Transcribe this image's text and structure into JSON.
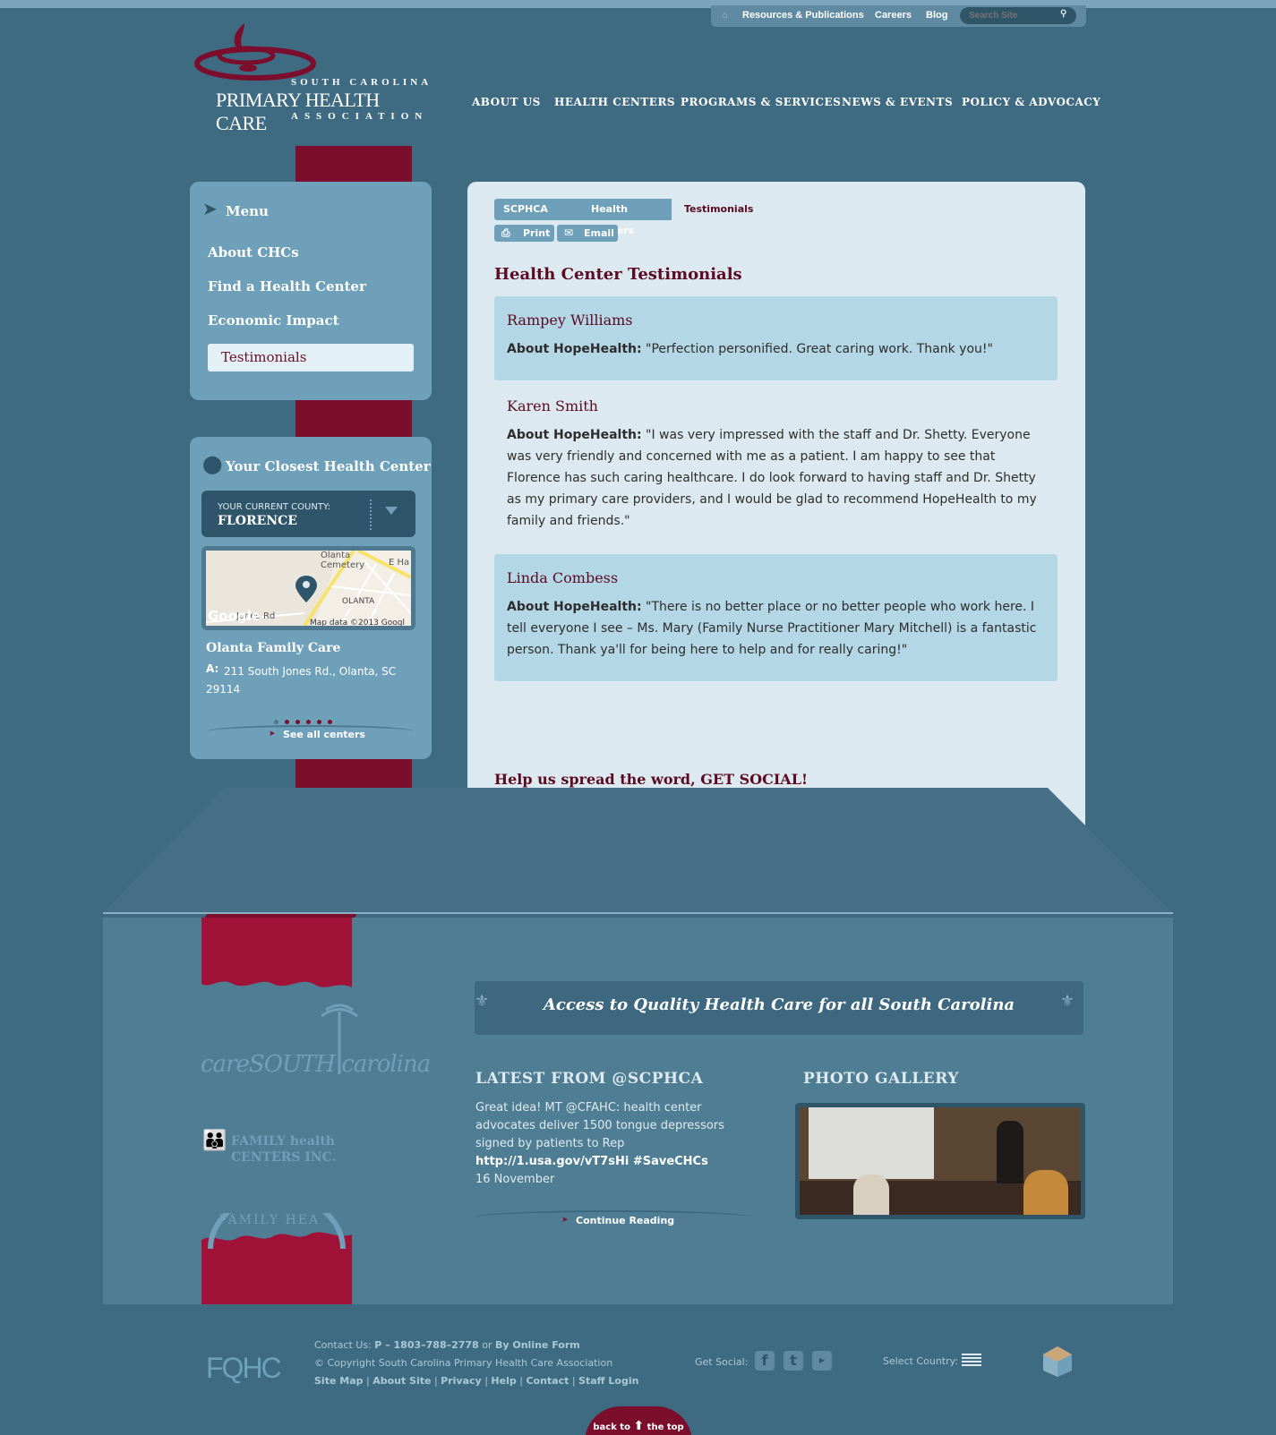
{
  "utility": {
    "links": [
      "Resources & Publications",
      "Careers",
      "Blog"
    ],
    "search_placeholder": "Search Site"
  },
  "logo": {
    "line1": "SOUTH CAROLINA",
    "line2": "PRIMARY HEALTH CARE",
    "line3": "ASSOCIATION"
  },
  "nav": [
    "ABOUT US",
    "HEALTH CENTERS",
    "PROGRAMS & SERVICES",
    "NEWS & EVENTS",
    "POLICY & ADVOCACY"
  ],
  "sidebar": {
    "menu_title": "Menu",
    "items": [
      "About CHCs",
      "Find a Health Center",
      "Economic Impact",
      "Testimonials"
    ],
    "closest_title": "Your Closest Health Center",
    "county_label": "YOUR CURRENT COUNTY:",
    "county_value": "FLORENCE",
    "map_labels": [
      "Olanta Cemetery",
      "E Ha",
      "OLANTA",
      "Jones Rd",
      "Google",
      "Map data ©2013 Googl"
    ],
    "center_name": "Olanta Family Care",
    "address_label": "A:",
    "address": "211 South Jones Rd., Olanta, SC 29114",
    "see_all": "See all centers"
  },
  "breadcrumb": [
    "SCPHCA Home",
    "Health Centers",
    "Testimonials"
  ],
  "tools": [
    "Print",
    "Email"
  ],
  "content": {
    "title": "Health Center Testimonials",
    "testimonials": [
      {
        "name": "Rampey Williams",
        "about": "About HopeHealth:",
        "text": "\"Perfection personified. Great caring work. Thank you!\""
      },
      {
        "name": "Karen Smith",
        "about": "About HopeHealth:",
        "text": "\"I was very impressed with the staff and Dr. Shetty. Everyone was very friendly and concerned with me as a patient. I am happy to see that Florence has such caring healthcare. I do look forward to having staff and Dr. Shetty as my primary care providers, and I would be glad to recommend HopeHealth to my family and friends.\""
      },
      {
        "name": "Linda Combess",
        "about": "About HopeHealth:",
        "text": "\"There is no better place or no better people who work here. I tell everyone I see – Ms. Mary (Family Nurse Practitioner Mary Mitchell) is a fantastic person. Thank ya'll for being here to help and for really caring!\""
      }
    ],
    "social_heading": "Help us spread the word, GET SOCIAL!",
    "social_icons": [
      "facebook-icon",
      "twitter-icon",
      "gmail-icon",
      "delicious-icon",
      "google-bookmarks-icon",
      "chrome-icon",
      "linkedin-icon",
      "reddit-icon",
      "evernote-icon",
      "tumblr-icon"
    ]
  },
  "bottom": {
    "tagline": "Access to Quality Health Care for all South Carolina",
    "latest_title": "LATEST FROM @SCPHCA",
    "tweet_lines": [
      "Great idea! MT @CFAHC: health center",
      "advocates deliver 1500 tongue depressors",
      "signed by patients to Rep",
      "http://1.usa.gov/vT7sHi #SaveCHCs"
    ],
    "tweet_date": "16 November",
    "continue": "Continue Reading",
    "gallery_title": "PHOTO GALLERY",
    "partners": [
      "careSOUTH carolina",
      "FAMILY health CENTERS INC.",
      "FAMILY HEA"
    ]
  },
  "footer": {
    "contact_label": "Contact Us:",
    "phone": "P – 1803–788–2778",
    "or": "or",
    "online_form": "By Online Form",
    "copyright": "© Copyright South Carolina Primary Health Care Association",
    "links": [
      "Site Map",
      "About Site",
      "Privacy",
      "Help",
      "Contact",
      "Staff Login"
    ],
    "get_social": "Get Social:",
    "select_country": "Select Country:",
    "fqhc": "FQHC",
    "back_to": "back to",
    "the_top": "the top"
  },
  "colors": {
    "background": "#3f6b82",
    "panel": "#6fa0b9",
    "maroon": "#7a0e2c",
    "content_bg": "#dde9f0"
  }
}
